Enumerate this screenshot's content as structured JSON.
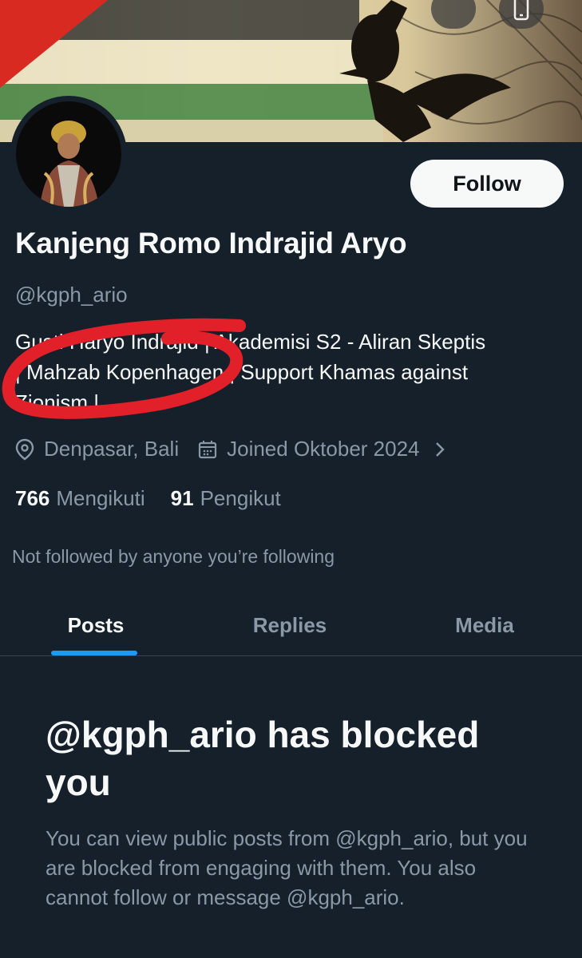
{
  "profile": {
    "name": "Kanjeng Romo Indrajid Aryo",
    "handle": "@kgph_ario",
    "bio_lines": [
      "Gusti Haryo Indrajid | Akademisi S2 - Aliran Skeptis",
      "| Mahzab Kopenhagen | Support Khamas against",
      "Zionism |"
    ],
    "location": "Denpasar, Bali",
    "joined": "Joined Oktober 2024",
    "following_count": "766",
    "following_label": "Mengikuti",
    "followers_count": "91",
    "followers_label": "Pengikut",
    "not_followed_text": "Not followed by anyone you’re following"
  },
  "actions": {
    "follow_label": "Follow"
  },
  "tabs": [
    {
      "label": "Posts",
      "active": true
    },
    {
      "label": "Replies",
      "active": false
    },
    {
      "label": "Media",
      "active": false
    }
  ],
  "blocked": {
    "title": "@kgph_ario has blocked you",
    "body": "You can view public posts from @kgph_ario, but you are blocked from engaging with them. You also cannot follow or message @kgph_ario."
  },
  "icons": {
    "location": "map-pin-icon",
    "calendar": "calendar-icon",
    "chevron": "chevron-right-icon",
    "top_right": "phone-icon"
  },
  "colors": {
    "background": "#15202b",
    "accent": "#1d9bf0",
    "secondary_text": "#8b98a5",
    "annotation": "#e2202a"
  }
}
